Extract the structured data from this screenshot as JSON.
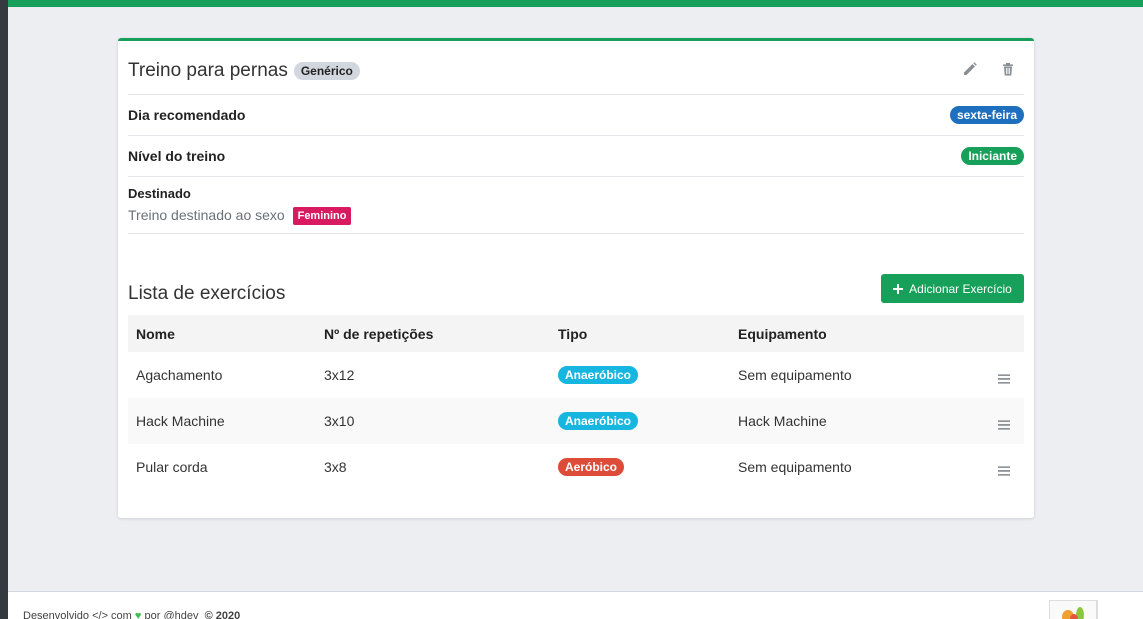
{
  "colors": {
    "accent": "#17a05a",
    "blue": "#1f6fbf",
    "cyan": "#17b6e0",
    "red": "#dd4b39",
    "pink": "#d81b60"
  },
  "card": {
    "title": "Treino para pernas",
    "title_badge": "Genérico",
    "edit_icon": "pencil-icon",
    "delete_icon": "trash-icon"
  },
  "info": {
    "day_label": "Dia recomendado",
    "day_value": "sexta-feira",
    "level_label": "Nível do treino",
    "level_value": "Iniciante",
    "dest_label": "Destinado",
    "dest_text": "Treino destinado ao sexo",
    "dest_badge": "Feminino"
  },
  "exercises": {
    "title": "Lista de exercícios",
    "add_button": "Adicionar Exercício",
    "columns": [
      "Nome",
      "Nº de repetições",
      "Tipo",
      "Equipamento"
    ],
    "rows": [
      {
        "name": "Agachamento",
        "reps": "3x12",
        "type": "Anaeróbico",
        "equipment": "Sem equipamento"
      },
      {
        "name": "Hack Machine",
        "reps": "3x10",
        "type": "Anaeróbico",
        "equipment": "Hack Machine"
      },
      {
        "name": "Pular corda",
        "reps": "3x8",
        "type": "Aeróbico",
        "equipment": "Sem equipamento"
      }
    ]
  },
  "footer": {
    "text_before": "Desenvolvido </> com",
    "text_after": "por @hdev",
    "copyright": "© 2020"
  }
}
